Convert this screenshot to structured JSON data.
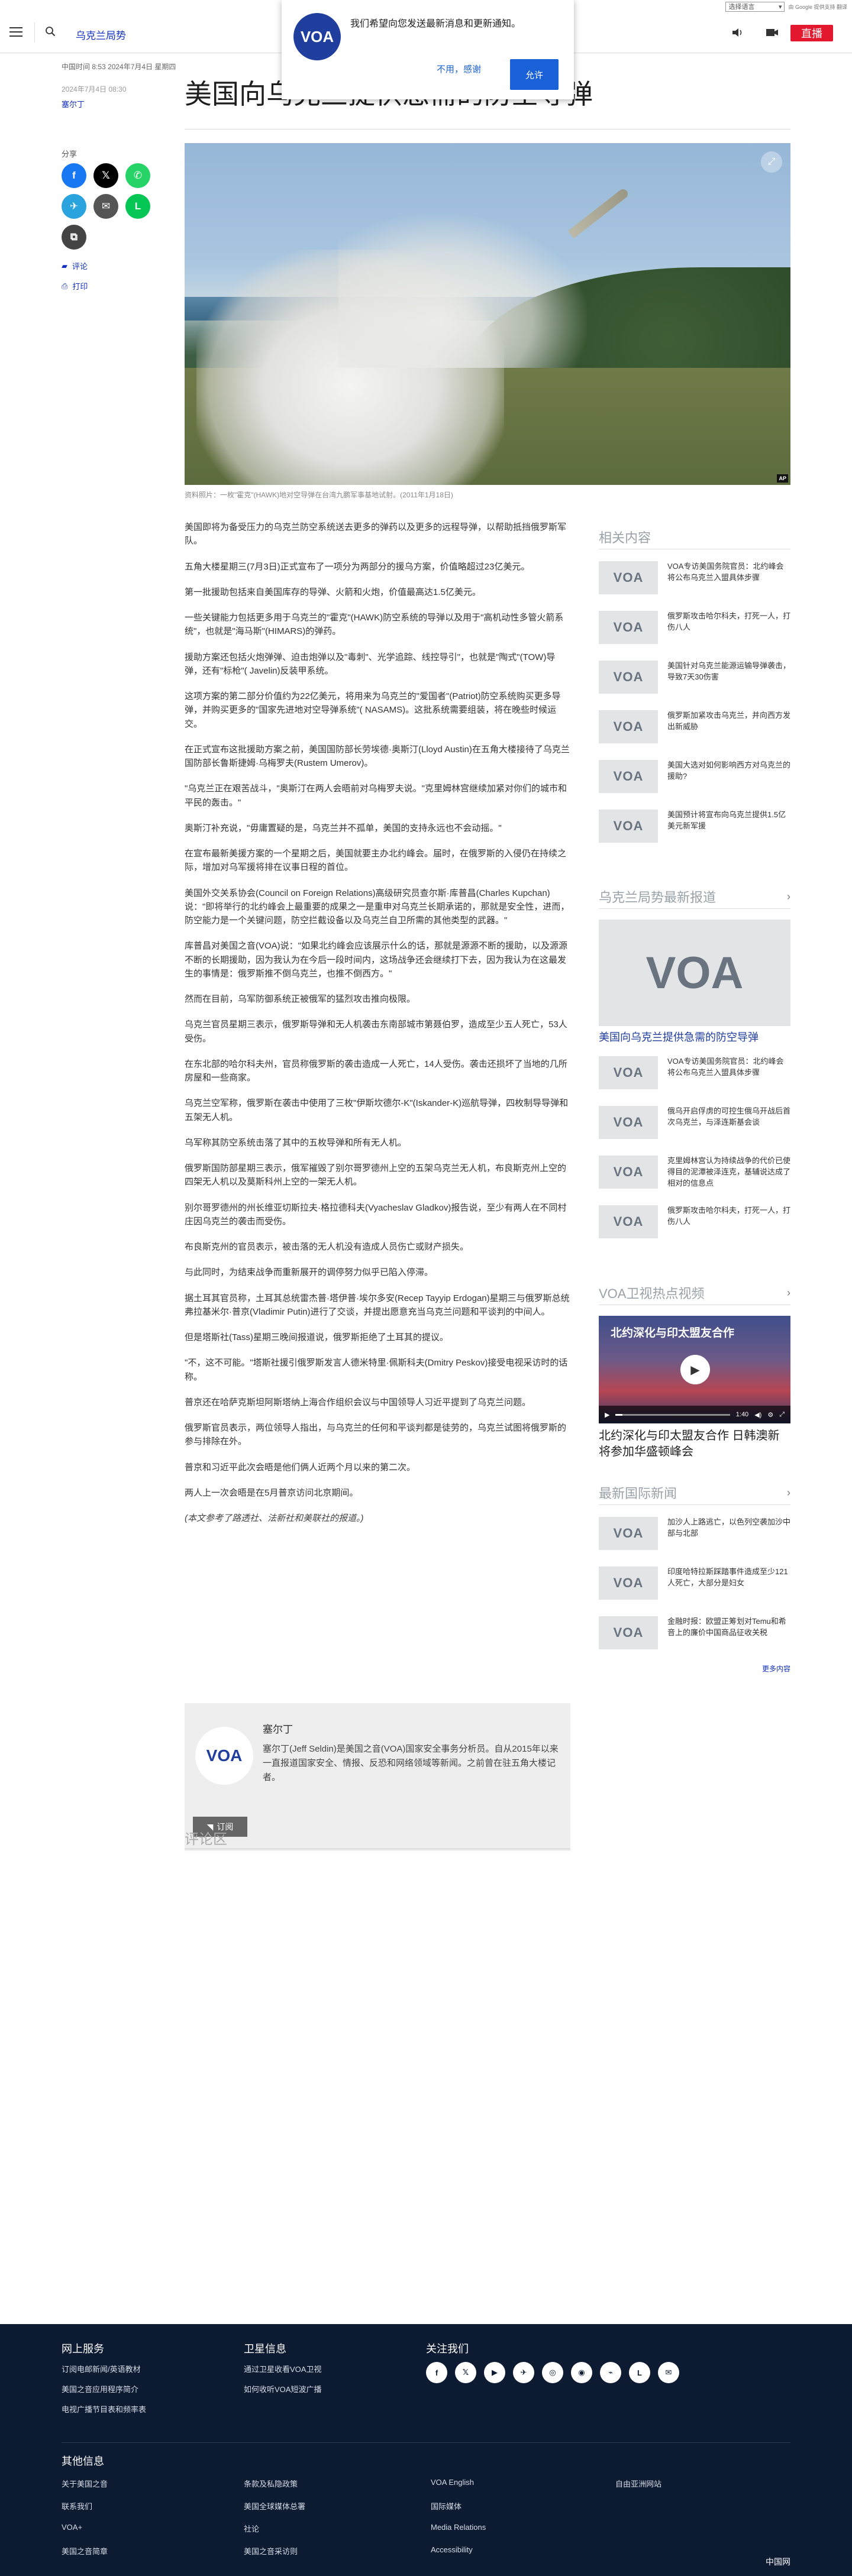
{
  "translate_bar": {
    "select_label": "选择语言",
    "powered_by": "由 Google 提供支持 翻译"
  },
  "header": {
    "section_title": "乌克兰局势",
    "live_label": "直播"
  },
  "notification": {
    "message": "我们希望向您发送最新消息和更新通知。",
    "decline_label": "不用，感谢",
    "accept_label": "允许",
    "logo_text": "VOA"
  },
  "article": {
    "timestamp": "中国时间 8:53 2024年7月4日 星期四",
    "date_updated": "2024年7月4日 08:30",
    "author_link": "塞尔丁",
    "title": "美国向乌克兰提供急需的防空导弹",
    "share_label": "分享",
    "comments_link": "评论",
    "print_link": "打印",
    "caption": "资料照片：一枚\"霍克\"(HAWK)地对空导弹在台湾九鹏军事基地试射。(2011年1月18日)",
    "photo_credit": "AP",
    "paragraphs": [
      "美国即将为备受压力的乌克兰防空系统送去更多的弹药以及更多的远程导弹，以帮助抵挡俄罗斯军队。",
      "五角大楼星期三(7月3日)正式宣布了一项分为两部分的援乌方案，价值略超过23亿美元。",
      "第一批援助包括来自美国库存的导弹、火箭和火炮，价值最高达1.5亿美元。",
      "一些关键能力包括更多用于乌克兰的\"霍克\"(HAWK)防空系统的导弹以及用于\"高机动性多管火箭系统\"，也就是\"海马斯\"(HIMARS)的弹药。",
      "援助方案还包括火炮弹弹、迫击炮弹以及\"毒刺\"、光学追踪、线控导引\"，也就是\"陶式\"(TOW)导弹，还有\"标枪\"( Javelin)反装甲系统。",
      "这项方案的第二部分价值约为22亿美元，将用来为乌克兰的\"爱国者\"(Patriot)防空系统购买更多导弹，并购买更多的\"国家先进地对空导弹系统\"( NASAMS)。这批系统需要组装，将在晚些时候运交。",
      "在正式宣布这批援助方案之前，美国国防部长劳埃德·奥斯汀(Lloyd Austin)在五角大楼接待了乌克兰国防部长鲁斯捷姆·乌梅罗夫(Rustem Umerov)。",
      "\"乌克兰正在艰苦战斗，\"奥斯汀在两人会晤前对乌梅罗夫说。\"克里姆林宫继续加紧对你们的城市和平民的轰击。\"",
      "奥斯汀补充说，\"毋庸置疑的是，乌克兰并不孤单，美国的支持永远也不会动摇。\"",
      "在宣布最新美援方案的一个星期之后，美国就要主办北约峰会。届时，在俄罗斯的入侵仍在持续之际，增加对乌军援将排在议事日程的首位。",
      "美国外交关系协会(Council on Foreign Relations)高级研究员查尔斯·库普昌(Charles Kupchan)说：\"即将举行的北约峰会上最重要的成果之一是重申对乌克兰长期承诺的，那就是安全性，进而，防空能力是一个关键问题，防空拦截设备以及乌克兰自卫所需的其他类型的武器。\"",
      "库普昌对美国之音(VOA)说：\"如果北约峰会应该展示什么的话，那就是源源不断的援助，以及源源不断的长期援助，因为我认为在今后一段时间内，这场战争还会继续打下去，因为我认为在这最发生的事情是：俄罗斯推不倒乌克兰，也推不倒西方。\"",
      "然而在目前，乌军防御系统正被俄军的猛烈攻击推向极限。",
      "乌克兰官员星期三表示，俄罗斯导弹和无人机袭击东南部城市第聂伯罗，造成至少五人死亡，53人受伤。",
      "在东北部的哈尔科夫州，官员称俄罗斯的袭击造成一人死亡，14人受伤。袭击还损坏了当地的几所房屋和一些商家。",
      "乌克兰空军称，俄罗斯在袭击中使用了三枚\"伊斯坎德尔-K\"(Iskander-K)巡航导弹，四枚制导导弹和五架无人机。",
      "乌军称其防空系统击落了其中的五枚导弹和所有无人机。",
      "俄罗斯国防部星期三表示，俄军摧毁了别尔哥罗德州上空的五架乌克兰无人机，布良斯克州上空的四架无人机以及莫斯科州上空的一架无人机。",
      "别尔哥罗德州的州长维亚切斯拉夫·格拉德科夫(Vyacheslav Gladkov)报告说，至少有两人在不同村庄因乌克兰的袭击而受伤。",
      "布良斯克州的官员表示，被击落的无人机没有造成人员伤亡或财产损失。",
      "与此同时，为结束战争而重新展开的调停努力似乎已陷入停滞。",
      "据土耳其官员称，土耳其总统雷杰普·塔伊普·埃尔多安(Recep Tayyip Erdogan)星期三与俄罗斯总统弗拉基米尔·普京(Vladimir Putin)进行了交谈，并提出愿意充当乌克兰问题和平谈判的中间人。",
      "但是塔斯社(Tass)星期三晚间报道说，俄罗斯拒绝了土耳其的提议。",
      "\"不，这不可能。\"塔斯社援引俄罗斯发言人德米特里·佩斯科夫(Dmitry Peskov)接受电视采访时的话称。",
      "普京还在哈萨克斯坦阿斯塔纳上海合作组织会议与中国领导人习近平提到了乌克兰问题。",
      "俄罗斯官员表示，两位领导人指出，与乌克兰的任何和平谈判都是徒劳的，乌克兰试图将俄罗斯的参与排除在外。",
      "普京和习近平此次会晤是他们俩人近两个月以来的第二次。",
      "两人上一次会晤是在5月普京访问北京期间。"
    ],
    "source_note": "(本文参考了路透社、法新社和美联社的报道。)"
  },
  "author_box": {
    "name": "塞尔丁",
    "bio": "塞尔丁(Jeff Seldin)是美国之音(VOA)国家安全事务分析员。自从2015年以来一直报道国家安全、情报、反恐和网络领域等新闻。之前曾在驻五角大楼记者。",
    "subscribe_label": "订阅",
    "logo_text": "VOA"
  },
  "comments_heading": "评论区",
  "rail": {
    "thumb_logo": "VOA",
    "related": {
      "heading": "相关内容",
      "items": [
        "VOA专访美国务院官员：北约峰会将公布乌克兰入盟具体步骤",
        "俄罗斯攻击哈尔科夫，打死一人，打伤八人",
        "美国针对乌克兰能源运输导弹袭击，导致7天30伤害",
        "俄罗斯加紧攻击乌克兰，并向西方发出新威胁",
        "美国大选对如何影响西方对乌克兰的援助?",
        "美国预计将宣布向乌克兰提供1.5亿美元新军援"
      ]
    },
    "ukraine": {
      "heading": "乌克兰局势最新报道",
      "featured_title": "美国向乌克兰提供急需的防空导弹",
      "items": [
        "VOA专访美国务院官员：北约峰会将公布乌克兰入盟具体步骤",
        "俄乌开启俘虏的可控生俄乌开战后首次乌克兰，与泽连斯基会谈",
        "克里姆林宫认为持续战争的代价已使得目的泥潭被泽连克，基辅说达成了相对的信息点",
        "俄罗斯攻击哈尔科夫，打死一人，打伤八人"
      ]
    },
    "video": {
      "heading": "VOA卫视热点视频",
      "overlay_title": "北约深化与印太盟友合作",
      "time": "1:40",
      "caption": "北约深化与印太盟友合作 日韩澳新将参加华盛顿峰会"
    },
    "world": {
      "heading": "最新国际新闻",
      "items": [
        "加沙人上路逃亡，以色列空袭加沙中部与北部",
        "印度哈特拉斯踩踏事件造成至少121人死亡，大部分是妇女",
        "金融时报：欧盟正筹划对Temu和希音上的廉价中国商品征收关税"
      ],
      "more_label": "更多内容"
    }
  },
  "footer": {
    "col1_heading": "网上服务",
    "col1_links": [
      "订阅电邮新闻/英语教材",
      "美国之音应用程序简介",
      "电视广播节目表和频率表"
    ],
    "col2_heading": "卫星信息",
    "col2_links": [
      "通过卫星收看VOA卫视",
      "如何收听VOA短波广播"
    ],
    "col3_heading": "关注我们",
    "social_icons": [
      "facebook-icon",
      "x-icon",
      "youtube-icon",
      "telegram-icon",
      "instagram-icon",
      "podcast-icon",
      "rss-icon",
      "line-icon",
      "email-icon"
    ],
    "social_glyphs": [
      "f",
      "𝕏",
      "▶",
      "✈",
      "◎",
      "◉",
      "⌁",
      "L",
      "✉"
    ],
    "other_heading": "其他信息",
    "other_links": [
      [
        "关于美国之音",
        "联系我们",
        "VOA+",
        "美国之音简章"
      ],
      [
        "条款及私隐政策",
        "美国全球媒体总署",
        "社论",
        "美国之音采访则"
      ],
      [
        "VOA English",
        "国际媒体",
        "Media Relations",
        "Accessibility"
      ],
      [
        "自由亚洲网站"
      ]
    ],
    "brand": "中国网"
  },
  "colors": {
    "accent": "#1330bf",
    "live_red": "#e3172d",
    "footer_bg": "#0c1b32",
    "voa_blue": "#1f3e9e"
  }
}
